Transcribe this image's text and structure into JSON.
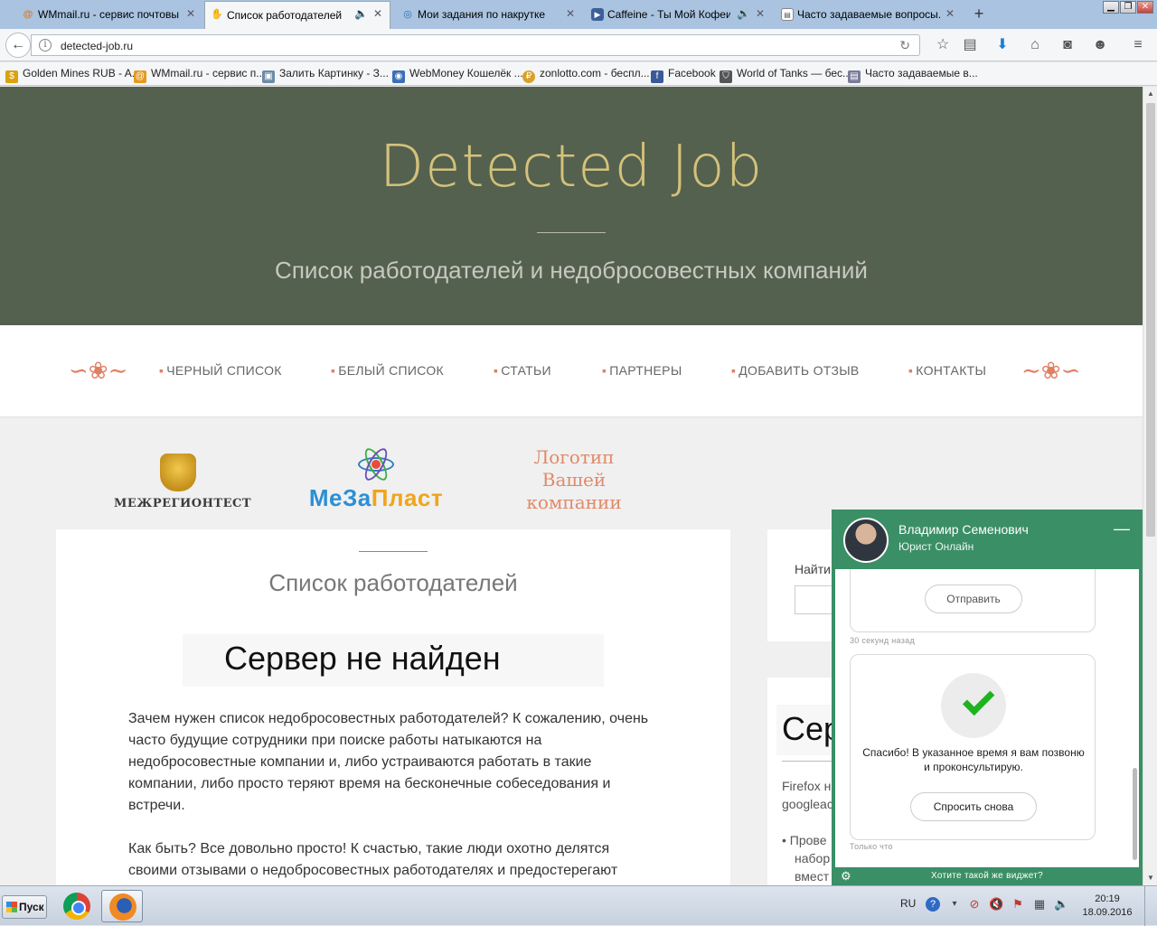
{
  "browser": {
    "tabs": [
      {
        "label": "WMmail.ru - сервис почтовы...",
        "icon": "at-icon",
        "active": false
      },
      {
        "label": "Список работодателей",
        "icon": "hand-icon",
        "active": true,
        "sound": true
      },
      {
        "label": "Мои задания по накрутке",
        "icon": "swirl-icon",
        "active": false
      },
      {
        "label": "Caffeine - Ты Мой Кофеин",
        "icon": "play-icon",
        "active": false,
        "sound": true
      },
      {
        "label": "Часто задаваемые вопросы...",
        "icon": "page-icon",
        "active": false
      }
    ],
    "new_tab": "+",
    "url": "detected-job.ru",
    "bookmarks": [
      {
        "label": "Golden Mines RUB - A...",
        "color": "#d9a20f"
      },
      {
        "label": "WMmail.ru - сервис п...",
        "color": "#e59a1f"
      },
      {
        "label": "Залить Картинку - З...",
        "color": "#6d8aa8"
      },
      {
        "label": "WebMoney Кошелёк ...",
        "color": "#3b6fb6"
      },
      {
        "label": "zonlotto.com - беспл...",
        "color": "#d8a22a"
      },
      {
        "label": "Facebook",
        "color": "#3b5998"
      },
      {
        "label": "World of Tanks — бес...",
        "color": "#555555"
      },
      {
        "label": "Часто задаваемые в...",
        "color": "#7a7a9a"
      }
    ]
  },
  "site": {
    "title": "Detected Job",
    "subtitle": "Список работодателей и недобросовестных компаний",
    "menu": [
      "ЧЕРНЫЙ СПИСОК",
      "БЕЛЫЙ СПИСОК",
      "СТАТЬИ",
      "ПАРТНЕРЫ",
      "ДОБАВИТЬ ОТЗЫВ",
      "КОНТАКТЫ"
    ],
    "logos": {
      "logo1": "МЕЖРЕГИОНТЕСТ",
      "logo2_a": "МеЗа",
      "logo2_b": "Пласт",
      "logo3": "Логотип Вашей компании"
    },
    "main": {
      "title": "Список работодателей",
      "error": "Сервер не найден",
      "para1": "Зачем нужен список недобросовестных работодателей? К сожалению, очень часто будущие сотрудники при поиске работы натыкаются на недобросовестные компании и, либо устраиваются работать в такие компании, либо просто теряют время на бесконечные собеседования и встречи.",
      "para2": "Как быть? Все довольно просто! К счастью, такие люди охотно делятся своими отзывами о недобросовестных работодателях и предостерегают"
    },
    "sidebar": {
      "search_label": "Найти",
      "error": "Сер",
      "p1": "Firefox н",
      "p2": "googleac",
      "list": [
        "Прове",
        "набор",
        "вмест"
      ]
    }
  },
  "chat": {
    "name": "Владимир Семенович",
    "role": "Юрист Онлайн",
    "send_label": "Отправить",
    "ts1": "30 секунд назад",
    "thanks": "Спасибо! В указанное время я вам позвоню и проконсультирую.",
    "ask_again": "Спросить снова",
    "ts2": "Только что",
    "footer": "Хотите такой же виджет?",
    "accent": "#3b8f66"
  },
  "taskbar": {
    "start": "Пуск",
    "lang": "RU",
    "time": "20:19",
    "date": "18.09.2016"
  }
}
